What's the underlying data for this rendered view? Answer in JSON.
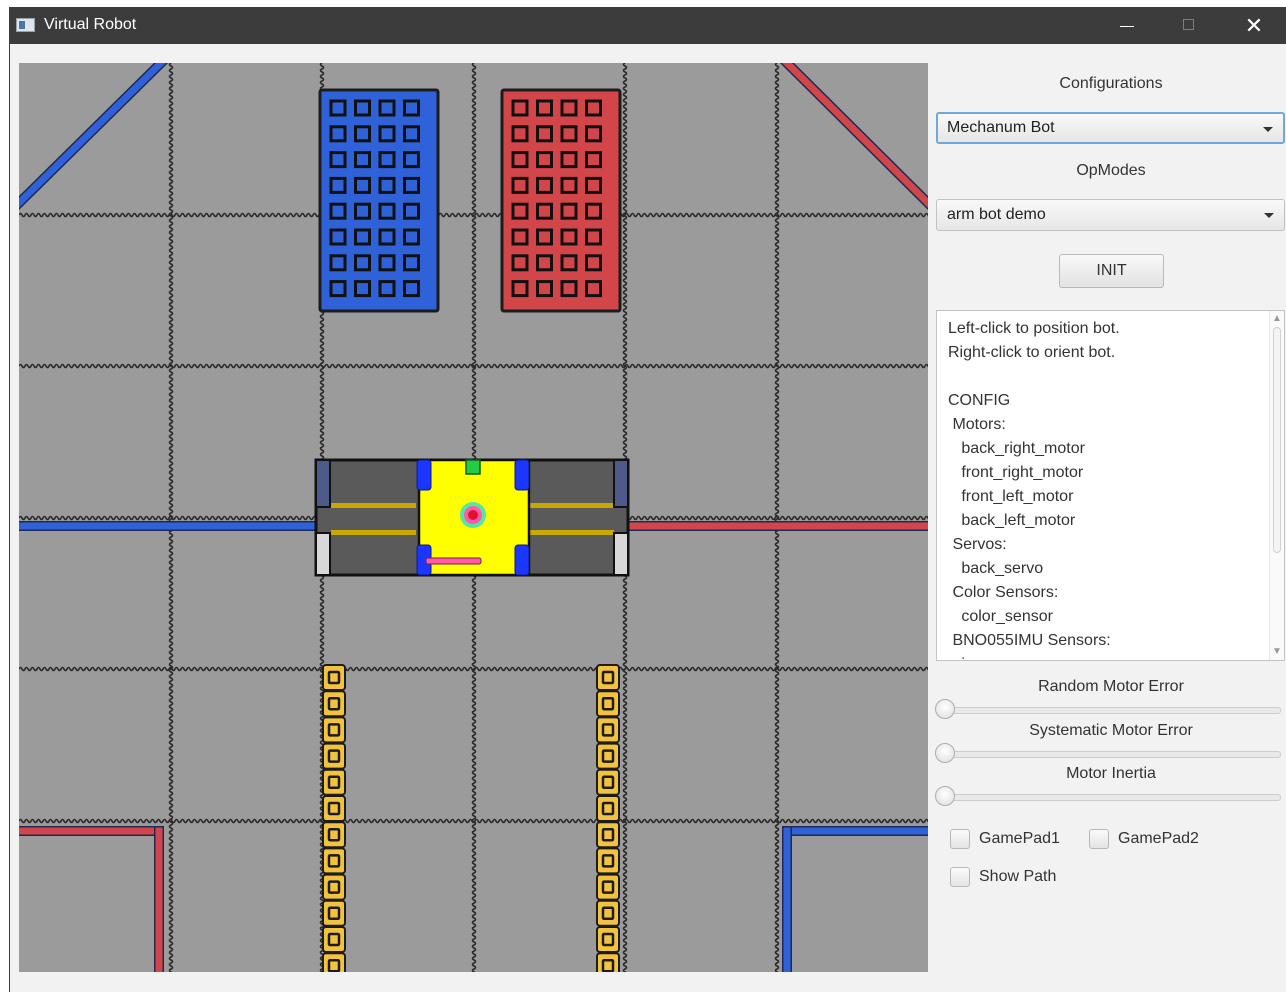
{
  "window": {
    "title": "Virtual Robot",
    "minimize_glyph": "—",
    "close_glyph": "✕"
  },
  "field": {
    "alliance_colors": {
      "blue": "#2f62d8",
      "red": "#d2464a",
      "yellow": "#f3c33e",
      "tile": "#9b9b9b"
    },
    "robot_colors": {
      "body": "#ffff00",
      "chassis": "#5a5a5a",
      "wheel": "#1a36ff",
      "stripe": "#c8a800",
      "marker": "#ff5aa8"
    }
  },
  "panel": {
    "configurations_label": "Configurations",
    "configuration_value": "Mechanum Bot",
    "opmodes_label": "OpModes",
    "opmode_value": "arm bot demo",
    "init_label": "INIT",
    "console_lines": [
      "Left-click to position bot.",
      "Right-click to orient bot.",
      "",
      "CONFIG",
      " Motors:",
      "   back_right_motor",
      "   front_right_motor",
      "   front_left_motor",
      "   back_left_motor",
      " Servos:",
      "   back_servo",
      " Color Sensors:",
      "   color_sensor",
      " BNO055IMU Sensors:",
      "   imu"
    ],
    "random_motor_error_label": "Random Motor Error",
    "random_motor_error_value": 0,
    "systematic_motor_error_label": "Systematic Motor Error",
    "systematic_motor_error_value": 0,
    "motor_inertia_label": "Motor Inertia",
    "motor_inertia_value": 0,
    "gamepad1_label": "GamePad1",
    "gamepad2_label": "GamePad2",
    "show_path_label": "Show Path"
  }
}
